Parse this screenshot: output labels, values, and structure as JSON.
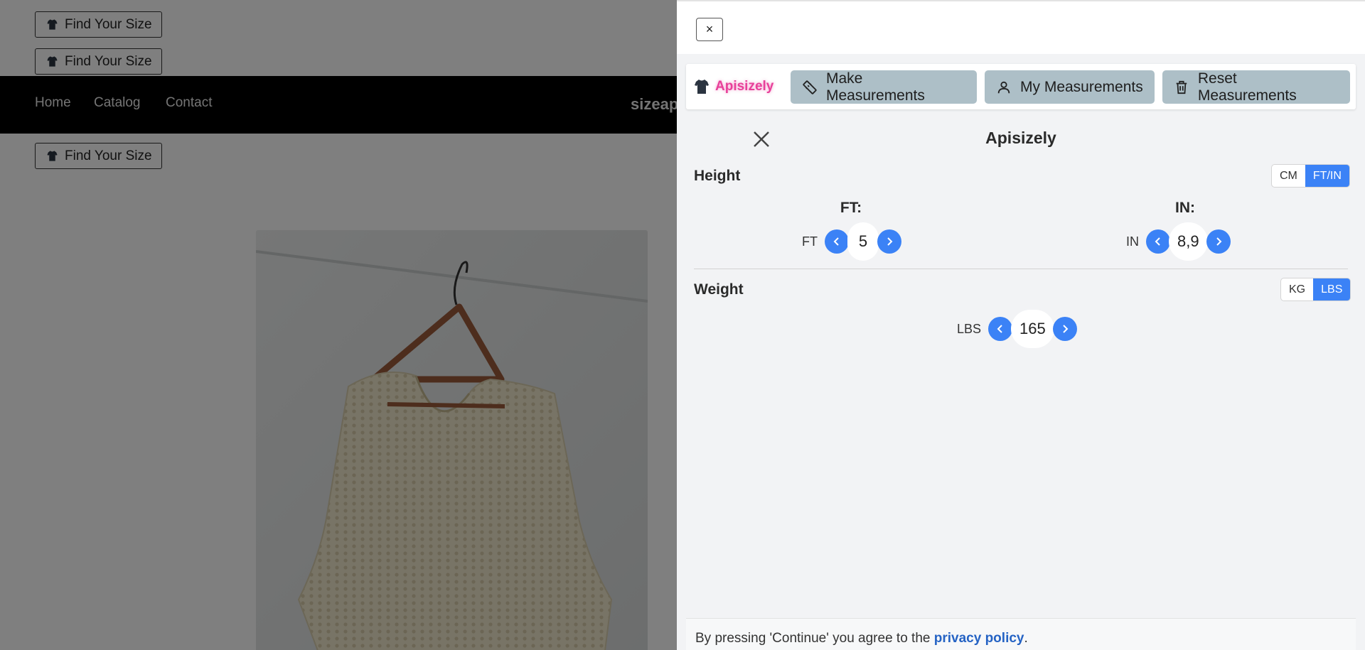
{
  "background": {
    "find_size_label": "Find Your Size",
    "nav": [
      "Home",
      "Catalog",
      "Contact"
    ],
    "brand": "sizeap"
  },
  "panel": {
    "close_glyph": "×",
    "toolbar": {
      "logo_text": "Apisizely",
      "make_measurements": "Make Measurements",
      "my_measurements": "My Measurements",
      "reset_measurements": "Reset Measurements"
    },
    "modal_title": "Apisizely",
    "height": {
      "label": "Height",
      "units": [
        "CM",
        "FT/IN"
      ],
      "active_unit": "FT/IN",
      "ft_header": "FT:",
      "in_header": "IN:",
      "ft_unit": "FT",
      "ft_value": "5",
      "in_unit": "IN",
      "in_value": "8,9"
    },
    "weight": {
      "label": "Weight",
      "units": [
        "KG",
        "LBS"
      ],
      "active_unit": "LBS",
      "unit": "LBS",
      "value": "165"
    },
    "footer": {
      "text_before": "By pressing 'Continue' you agree to the ",
      "link": "privacy policy",
      "text_after": "."
    }
  },
  "colors": {
    "accent": "#3b82f6",
    "logo_pink": "#e8409a",
    "toolbar_button": "#adbfc7"
  },
  "icons": [
    "shirt-icon",
    "ruler-icon",
    "user-icon",
    "trash-icon",
    "close-icon",
    "chevron-left-icon",
    "chevron-right-icon"
  ]
}
